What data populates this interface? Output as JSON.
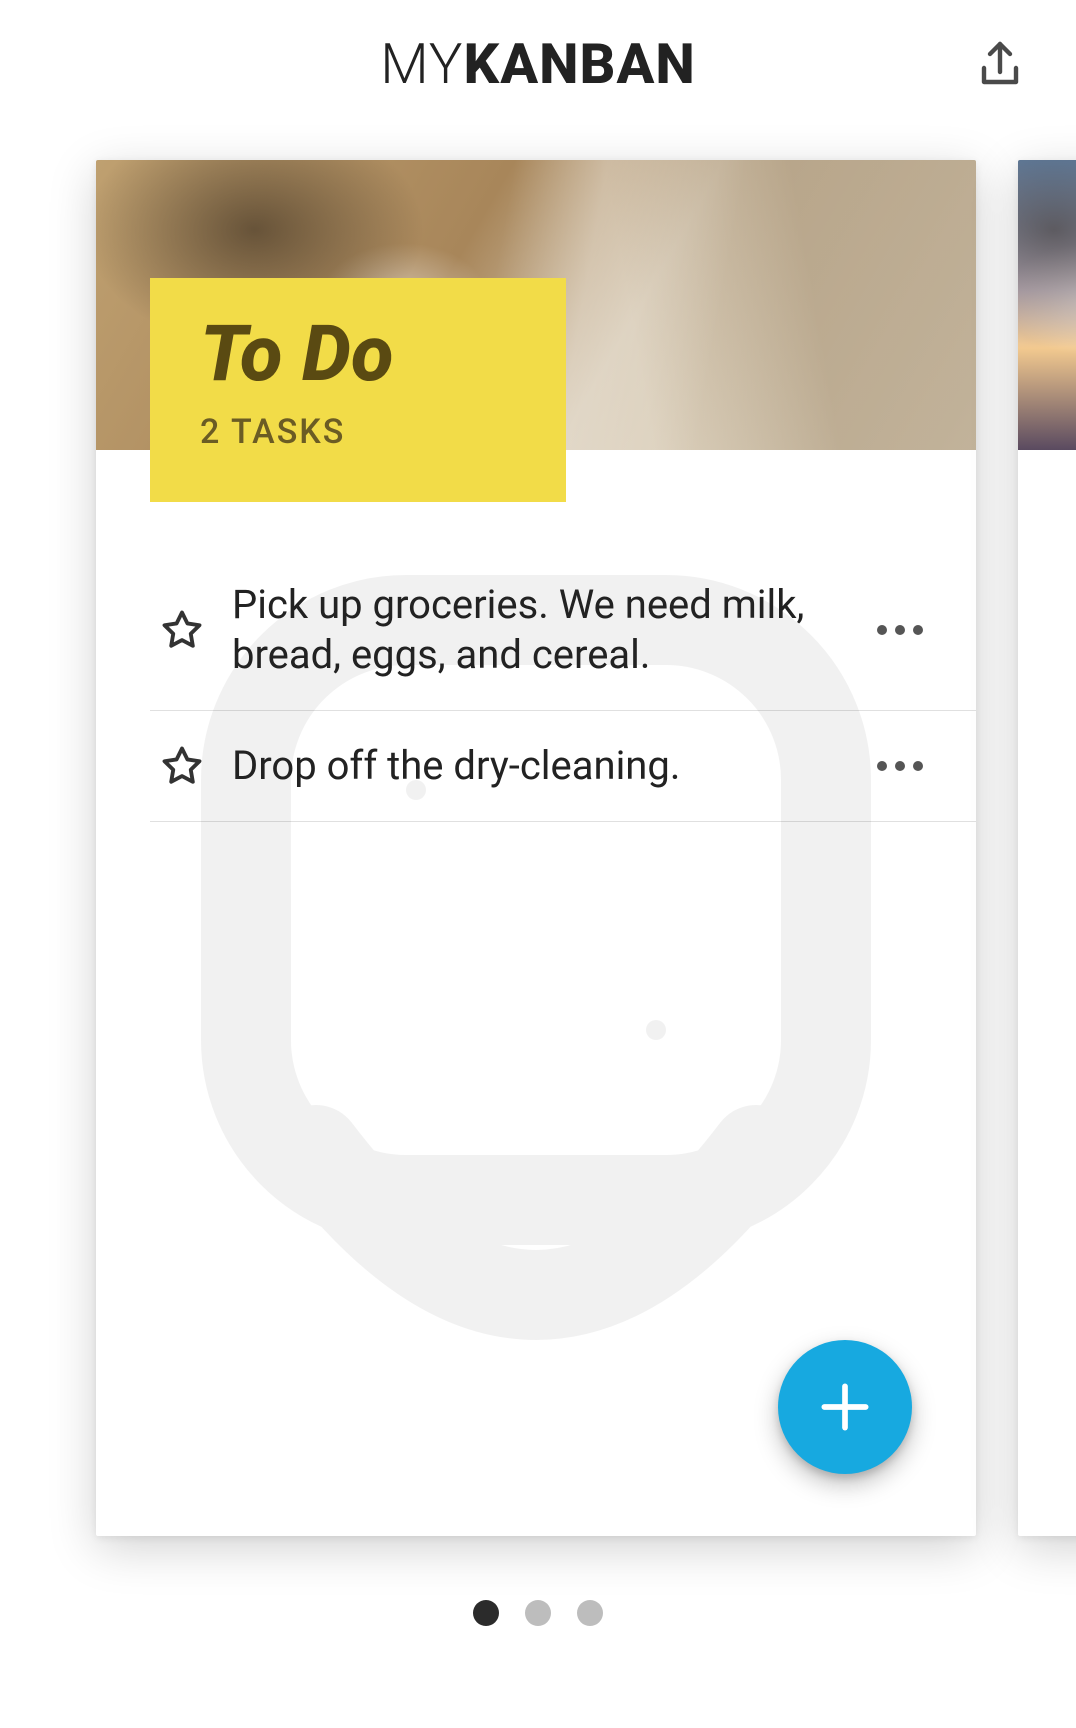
{
  "app": {
    "titlePrefix": "MY",
    "titleSuffix": "KANBAN"
  },
  "board": {
    "title": "To Do",
    "taskCountLabel": "2 TASKS",
    "tasks": [
      {
        "text": "Pick up groceries. We need milk, bread, eggs, and cereal.",
        "starred": false
      },
      {
        "text": "Drop off the dry-cleaning.",
        "starred": false
      }
    ]
  },
  "pager": {
    "count": 3,
    "active": 0
  },
  "icons": {
    "share": "share-icon",
    "star": "star-outline-icon",
    "more": "more-horizontal-icon",
    "add": "plus-icon"
  },
  "colors": {
    "accent": "#17a9e0",
    "chip": "#f2dc48",
    "chipText": "#5a4a12"
  }
}
